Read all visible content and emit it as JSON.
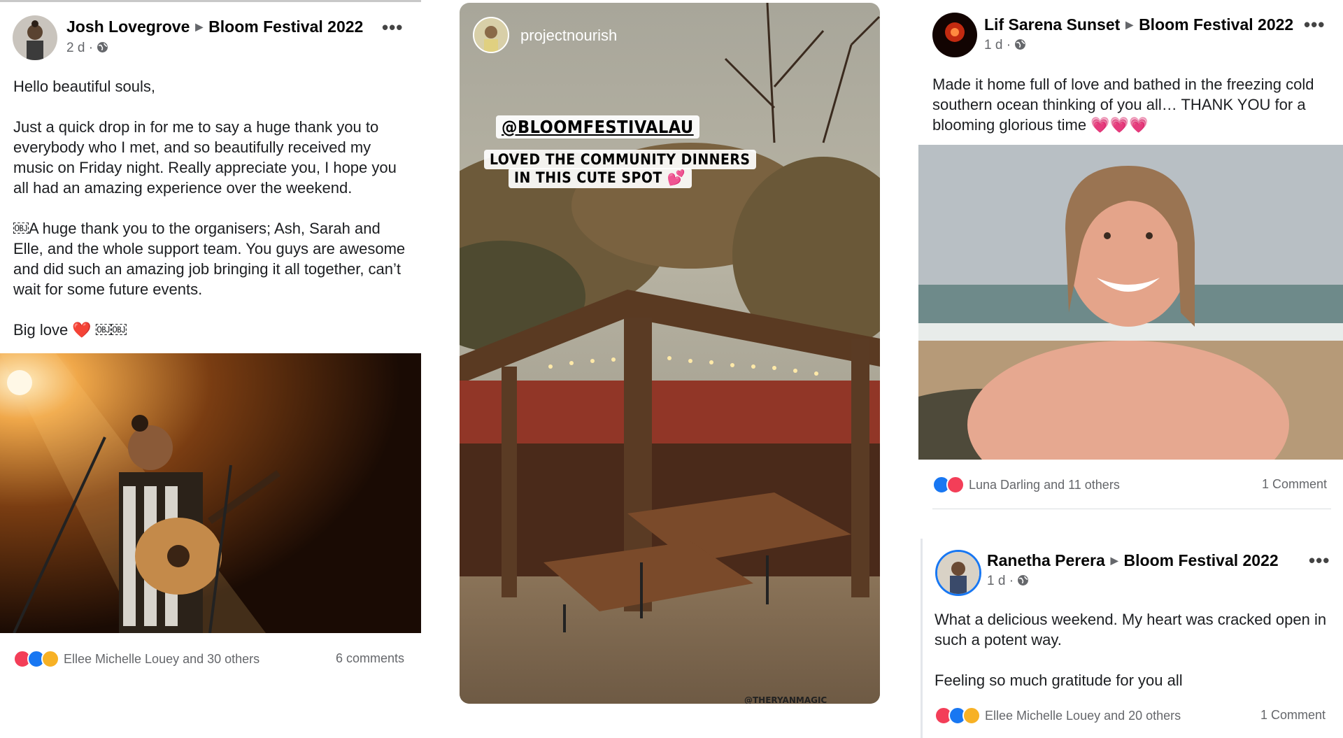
{
  "post1": {
    "author": "Josh Lovegrove",
    "group": "Bloom Festival 2022",
    "time": "2 d",
    "more_label": "•••",
    "paragraphs": [
      "Hello beautiful souls,",
      "Just a quick drop in for me to say a huge thank you to everybody who I met, and so beautifully received my music on Friday night. Really appreciate you, I hope you all had an amazing experience over the weekend.",
      "￼A huge thank you to the organisers; Ash, Sarah and Elle, and the whole support team. You guys are awesome and did such an amazing job bringing it all together, can’t wait for some future events.",
      "Big love ❤️ ￼￼"
    ],
    "reactions_text": "Ellee Michelle Louey and 30 others",
    "comments": "6 comments"
  },
  "story": {
    "username": "projectnourish",
    "tag": "@BLOOMFESTIVALAU",
    "caption_line1": "LOVED THE COMMUNITY DINNERS",
    "caption_line2": "IN THIS CUTE SPOT 💕",
    "watermark": "@THERYANMAGIC"
  },
  "post2": {
    "author": "Lif Sarena Sunset",
    "group": "Bloom Festival 2022",
    "time": "1 d",
    "more_label": "•••",
    "paragraphs": [
      "Made it home full of love and bathed in the freezing cold southern ocean thinking of you all… THANK YOU for a blooming glorious time 💗💗💗"
    ],
    "reactions_text": "Luna Darling and 11 others",
    "comments": "1 Comment"
  },
  "post3": {
    "author": "Ranetha Perera",
    "group": "Bloom Festival 2022",
    "time": "1 d",
    "more_label": "•••",
    "paragraphs": [
      "What a delicious weekend. My heart was cracked open in such a potent way.",
      "Feeling so much gratitude for you all"
    ],
    "reactions_text": "Ellee Michelle Louey and 20 others",
    "comments": "1 Comment"
  },
  "colors": {
    "like_blue": "#1877f2",
    "love_red": "#f33e58",
    "care_yellow": "#f7b125",
    "meta_gray": "#65676b"
  }
}
